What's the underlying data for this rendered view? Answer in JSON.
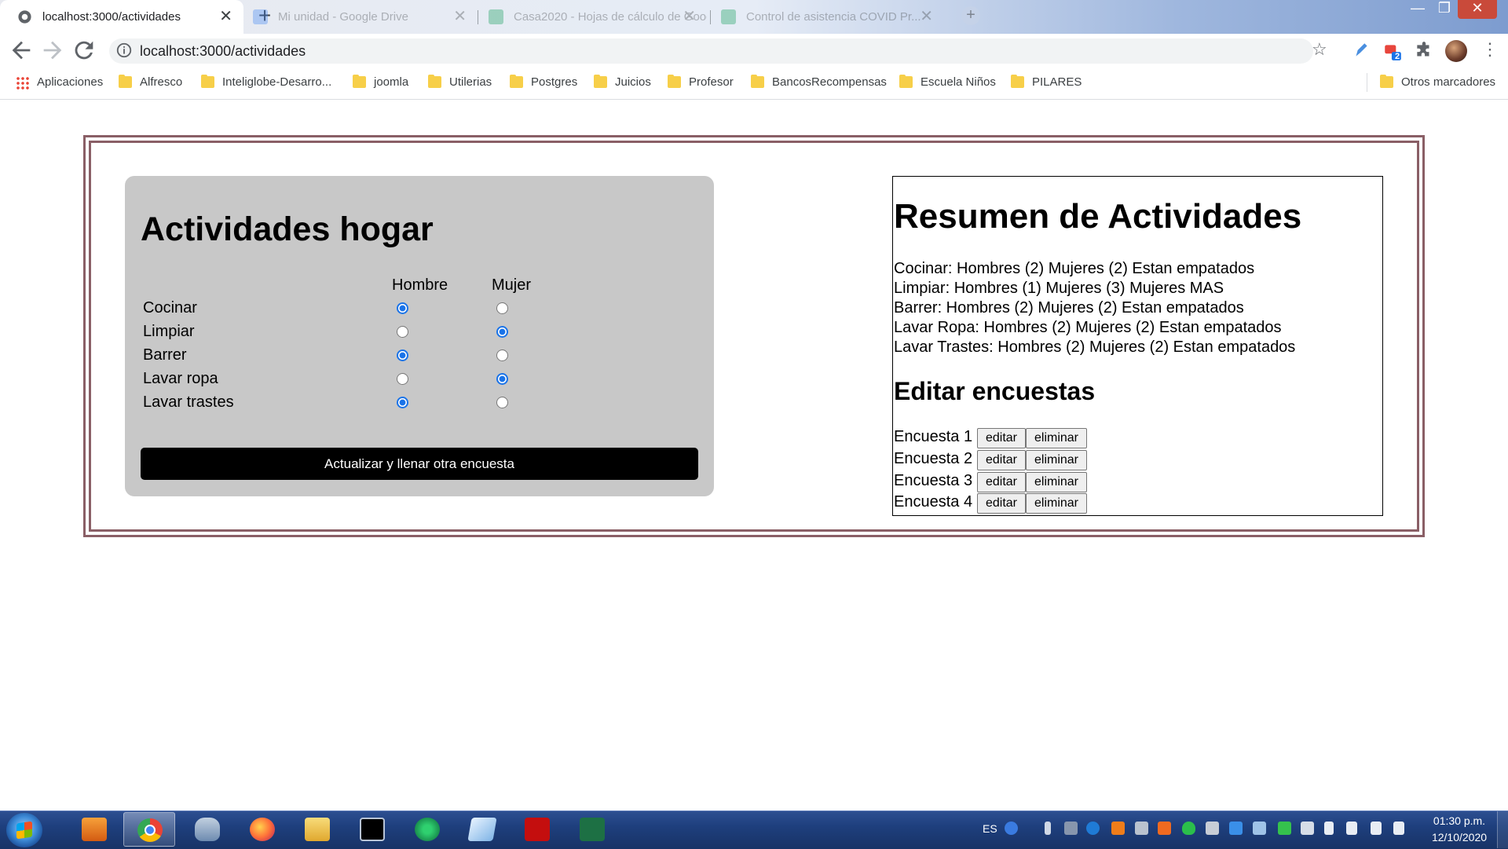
{
  "browser": {
    "tabs": [
      {
        "title": "localhost:3000/actividades",
        "active": true
      },
      {
        "title": "Mi unidad - Google Drive",
        "active": false
      },
      {
        "title": "Casa2020 - Hojas de cálculo de Google",
        "active": false
      },
      {
        "title": "Control de asistencia COVID Pr...",
        "active": false
      }
    ],
    "close_glyph": "✕",
    "new_tab_glyph": "+",
    "url": "localhost:3000/actividades",
    "window_controls": [
      "—",
      "❐",
      "✕"
    ],
    "bookmarks": [
      "Aplicaciones",
      "Alfresco",
      "Inteliglobe-Desarro...",
      "joomla",
      "Utilerias",
      "Postgres",
      "Juicios",
      "Profesor",
      "BancosRecompensas",
      "Escuela Niños",
      "PILARES"
    ],
    "other_bookmarks": "Otros marcadores",
    "extension_badge": "2"
  },
  "survey": {
    "title": "Actividades hogar",
    "col_hombre": "Hombre",
    "col_mujer": "Mujer",
    "rows": [
      {
        "label": "Cocinar",
        "hombre": true,
        "mujer": false
      },
      {
        "label": "Limpiar",
        "hombre": false,
        "mujer": true
      },
      {
        "label": "Barrer",
        "hombre": true,
        "mujer": false
      },
      {
        "label": "Lavar ropa",
        "hombre": false,
        "mujer": true
      },
      {
        "label": "Lavar trastes",
        "hombre": true,
        "mujer": false
      }
    ],
    "submit_label": "Actualizar y llenar otra encuesta"
  },
  "summary": {
    "title": "Resumen de Actividades",
    "lines": [
      "Cocinar: Hombres (2) Mujeres (2) Estan empatados",
      "Limpiar: Hombres (1) Mujeres (3) Mujeres MAS",
      "Barrer: Hombres (2) Mujeres (2) Estan empatados",
      "Lavar Ropa: Hombres (2) Mujeres (2) Estan empatados",
      "Lavar Trastes: Hombres (2) Mujeres (2) Estan empatados"
    ],
    "edit_title": "Editar encuestas",
    "surveys": [
      "Encuesta 1",
      "Encuesta 2",
      "Encuesta 3",
      "Encuesta 4"
    ],
    "edit_label": "editar",
    "delete_label": "eliminar"
  },
  "taskbar": {
    "language": "ES",
    "time": "01:30 p.m.",
    "date": "12/10/2020"
  }
}
